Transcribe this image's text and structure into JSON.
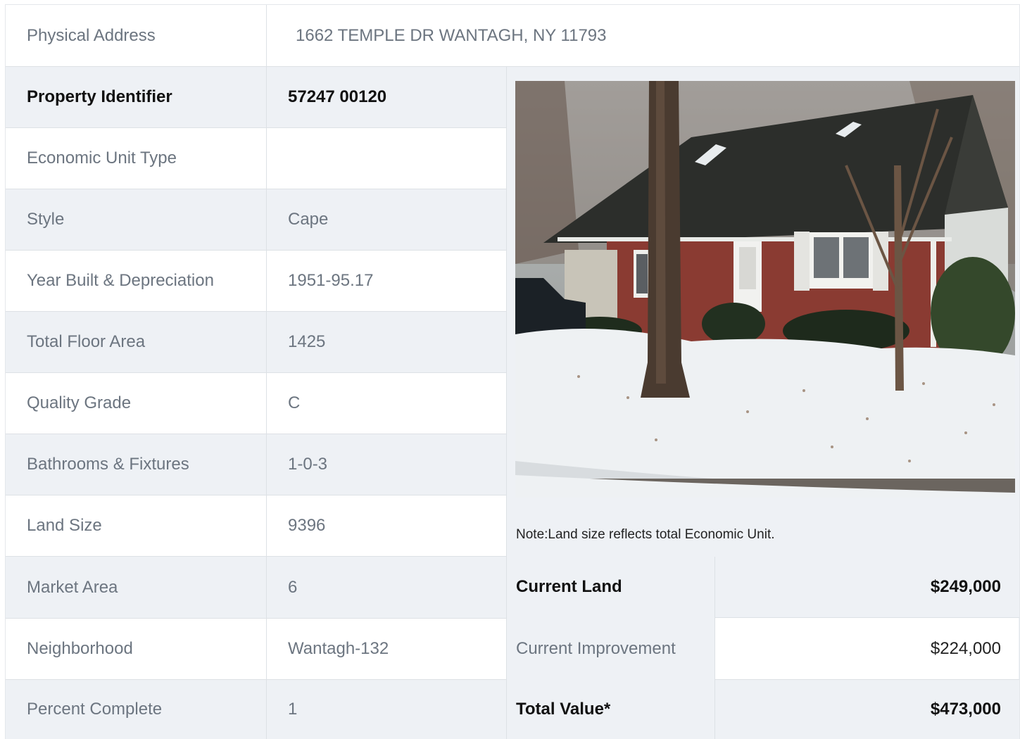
{
  "address": {
    "label": "Physical Address",
    "value": "1662  TEMPLE DR  WANTAGH, NY  11793"
  },
  "details": [
    {
      "label": "Property Identifier",
      "value": "57247  00120"
    },
    {
      "label": "Economic Unit Type",
      "value": ""
    },
    {
      "label": "Style",
      "value": "Cape"
    },
    {
      "label": "Year Built & Depreciation",
      "value": "1951-95.17"
    },
    {
      "label": "Total Floor Area",
      "value": "1425"
    },
    {
      "label": "Quality Grade",
      "value": "C"
    },
    {
      "label": "Bathrooms & Fixtures",
      "value": "1-0-3"
    },
    {
      "label": "Land Size",
      "value": "9396"
    },
    {
      "label": "Market Area",
      "value": "6"
    },
    {
      "label": "Neighborhood",
      "value": "Wantagh-132"
    },
    {
      "label": "Percent Complete",
      "value": "1"
    }
  ],
  "note": "Note:Land size reflects total Economic Unit.",
  "values": [
    {
      "label": "Current Land",
      "value": "$249,000"
    },
    {
      "label": "Current Improvement",
      "value": "$224,000"
    },
    {
      "label": "Total Value*",
      "value": "$473,000"
    }
  ],
  "colors": {
    "row_alt": "#eef1f5",
    "border": "#dde1e5",
    "text": "#6c7580"
  }
}
